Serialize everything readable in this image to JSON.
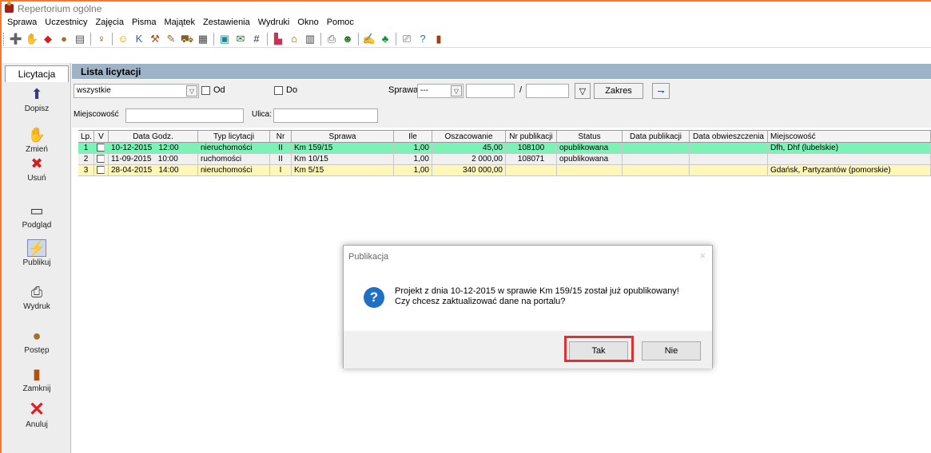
{
  "window": {
    "title": "Repertorium ogólne"
  },
  "menu": [
    "Sprawa",
    "Uczestnicy",
    "Zajęcia",
    "Pisma",
    "Majątek",
    "Zestawienia",
    "Wydruki",
    "Okno",
    "Pomoc"
  ],
  "sidebar": {
    "tab": "Licytacja",
    "items": [
      {
        "label": "Dopisz",
        "icon": "add-icon"
      },
      {
        "label": "Zmień",
        "icon": "edit-hand-icon"
      },
      {
        "label": "Usuń",
        "icon": "delete-icon"
      },
      {
        "label": "Podgląd",
        "icon": "preview-icon"
      },
      {
        "label": "Publikuj",
        "icon": "publish-icon"
      },
      {
        "label": "Wydruk",
        "icon": "printer-icon"
      },
      {
        "label": "Postęp",
        "icon": "progress-icon"
      },
      {
        "label": "Zamknij",
        "icon": "exit-door-icon"
      },
      {
        "label": "Anuluj",
        "icon": "cancel-x-icon"
      }
    ]
  },
  "panel": {
    "title": "Lista licytacji"
  },
  "filters": {
    "scope_value": "wszystkie",
    "od_label": "Od",
    "do_label": "Do",
    "sprawa_label": "Sprawa",
    "sprawa_value": "---",
    "slash": "/",
    "zakres_label": "Zakres",
    "miejscowosc_label": "Miejscowość",
    "ulica_label": "Ulica:"
  },
  "table": {
    "headers": [
      "Lp.",
      "V",
      "Data   Godz.",
      "Typ licytacji",
      "Nr",
      "Sprawa",
      "Ile",
      "Oszacowanie",
      "Nr publikacji",
      "Status",
      "Data publikacji",
      "Data obwieszczenia",
      "Miejscowość"
    ],
    "rows": [
      {
        "lp": "1",
        "date": "10-12-2015",
        "time": "12:00",
        "type": "nieruchomości",
        "nr": "II",
        "sprawa": "Km 159/15",
        "ile": "1,00",
        "osz": "45,00",
        "nrpub": "108100",
        "status": "opublikowana",
        "datapub": "",
        "dataobw": "",
        "miejsc": "Dfh, Dhf (lubelskie)"
      },
      {
        "lp": "2",
        "date": "11-09-2015",
        "time": "10:00",
        "type": "ruchomości",
        "nr": "II",
        "sprawa": "Km 10/15",
        "ile": "1,00",
        "osz": "2 000,00",
        "nrpub": "108071",
        "status": "opublikowana",
        "datapub": "",
        "dataobw": "",
        "miejsc": ""
      },
      {
        "lp": "3",
        "date": "28-04-2015",
        "time": "14:00",
        "type": "nieruchomości",
        "nr": "I",
        "sprawa": "Km 5/15",
        "ile": "1,00",
        "osz": "340 000,00",
        "nrpub": "",
        "status": "",
        "datapub": "",
        "dataobw": "",
        "miejsc": "Gdańsk, Partyzantów (pomorskie)"
      }
    ]
  },
  "dialog": {
    "title": "Publikacja",
    "line1": "Projekt z dnia 10-12-2015 w sprawie Km 159/15 został już opublikowany!",
    "line2": "Czy chcesz zaktualizować dane na portalu?",
    "yes": "Tak",
    "no": "Nie",
    "close": "×",
    "icon": "?"
  },
  "colors": {
    "accent_border": "#f07a2e",
    "panel_header": "#9fb3c8",
    "row_selected": "#7cf3b6",
    "row_pending": "#fff7b8",
    "highlight": "#e52e2e"
  }
}
